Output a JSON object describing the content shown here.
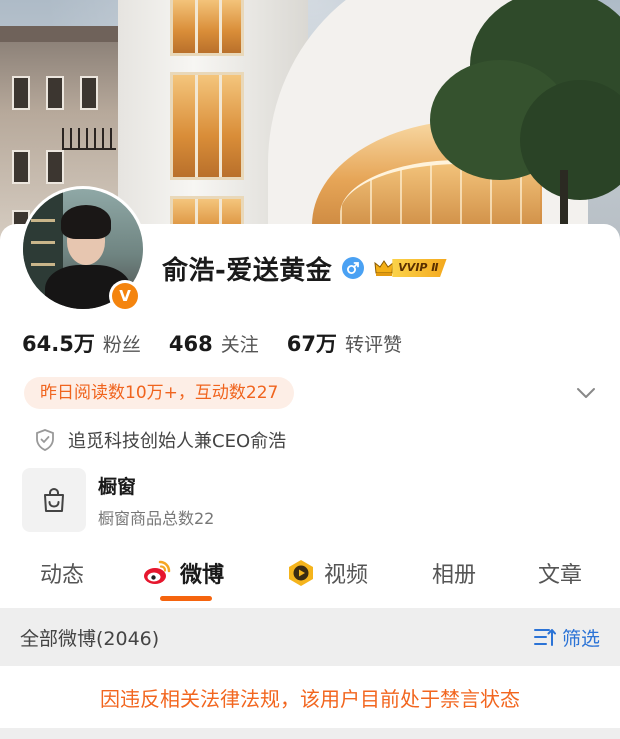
{
  "profile": {
    "name": "俞浩-爱送黄金",
    "gender_icon": "male-symbol",
    "vip_badge": "VVIP Ⅱ",
    "verified_badge": "V",
    "stats": [
      {
        "value": "64.5万",
        "label": "粉丝"
      },
      {
        "value": "468",
        "label": "关注"
      },
      {
        "value": "67万",
        "label": "转评赞"
      }
    ],
    "read_stats": "昨日阅读数10万+，互动数227",
    "certification": "追觅科技创始人兼CEO俞浩",
    "showcase": {
      "title": "橱窗",
      "subtitle": "橱窗商品总数22"
    }
  },
  "tabs": [
    {
      "label": "动态",
      "active": false
    },
    {
      "label": "微博",
      "active": true,
      "icon": "weibo-logo-icon"
    },
    {
      "label": "视频",
      "active": false,
      "icon": "video-play-icon"
    },
    {
      "label": "相册",
      "active": false
    },
    {
      "label": "文章",
      "active": false
    }
  ],
  "feed": {
    "title": "全部微博(2046)",
    "filter_label": "筛选"
  },
  "notice": "因违反相关法律法规，该用户目前处于禁言状态",
  "colors": {
    "accent": "#f5640e",
    "link": "#2b73d6",
    "pill_bg": "#fdeee6"
  }
}
